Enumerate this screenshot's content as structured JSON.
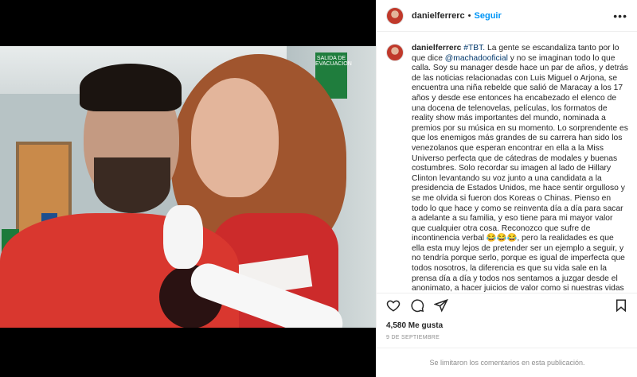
{
  "post": {
    "username": "danielferrerc",
    "separator": "•",
    "follow_label": "Seguir",
    "more_glyph": "•••",
    "photo_alt": "selfie",
    "photo_sign": "SALIDA DE EVACUACION"
  },
  "caption": {
    "username": "danielferrerc",
    "hashtag": "#TBT.",
    "text_1": " La gente se escandaliza tanto por lo que dice ",
    "mention": "@machadooficial",
    "text_2": " y no se imaginan todo lo que calla. Soy su manager desde hace un par de años, y detrás de las noticias relacionadas con Luis Miguel o Arjona, se encuentra una niña rebelde que salió de Maracay a los 17 años y desde ese entonces ha encabezado el elenco de una docena de telenovelas, películas, los formatos de reality show más importantes del mundo, nominada a premios por su música en su momento. Lo sorprendente es que los enemigos más grandes de su carrera han sido los venezolanos que esperan encontrar en ella a la Miss Universo perfecta que de cátedras de modales y buenas costumbres. Solo recordar su imagen al lado de Hillary Clinton levantando su voz junto a una candidata a la presidencia de Estados Unidos, me hace sentir orgulloso y se me olvida si fueron dos Koreas o Chinas. Pienso en todo lo que hace y como se reinventa día a día para sacar a adelante a su familia, y eso tiene para mi mayor valor que cualquier otra cosa. Reconozco que sufre de incontinencia verbal 😂😂😂, pero la realidades es que ella esta muy lejos de pretender ser un ejemplo a seguir, y no tendría porque serlo, porque es igual de imperfecta que todos nosotros, la diferencia es que su vida sale en la prensa día a día y todos nos sentamos a juzgar desde el anonimato, a hacer juicios de valor como si nuestras vidas fueran un ejemplo de grandeza para el mundo. Alicia desde que esta representada por este servidor ha realizado 11 proyectos en dos años, el continente entero le da más valor como artista"
  },
  "actions": {
    "icons": [
      "heart-icon",
      "comment-icon",
      "share-icon",
      "bookmark-icon"
    ]
  },
  "likes": "4,580 Me gusta",
  "date": "9 DE SEPTIEMBRE",
  "footer": "Se limitaron los comentarios en esta publicación.",
  "colors": {
    "link_blue": "#0095f6",
    "mention_blue": "#00376b",
    "text": "#262626",
    "muted": "#8e8e8e"
  }
}
